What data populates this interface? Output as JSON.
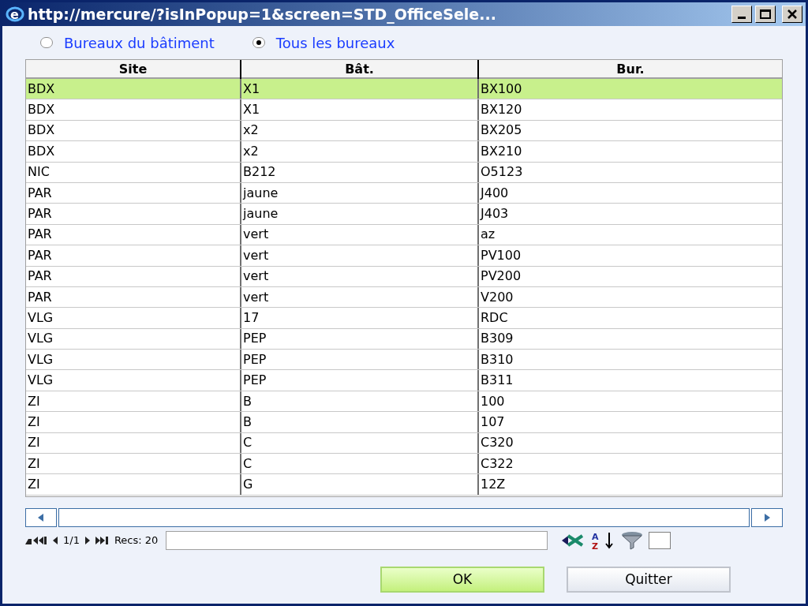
{
  "window": {
    "logo_letter": "e",
    "title": "http://mercure/?isInPopup=1&screen=STD_OfficeSele..."
  },
  "scope_options": [
    {
      "label": "Bureaux du bâtiment",
      "selected": false
    },
    {
      "label": "Tous les bureaux",
      "selected": true
    }
  ],
  "table": {
    "columns": [
      "Site",
      "Bât.",
      "Bur."
    ],
    "rows": [
      {
        "cells": [
          "BDX",
          "X1",
          "BX100"
        ],
        "selected": true
      },
      {
        "cells": [
          "BDX",
          "X1",
          "BX120"
        ],
        "selected": false
      },
      {
        "cells": [
          "BDX",
          "x2",
          "BX205"
        ],
        "selected": false
      },
      {
        "cells": [
          "BDX",
          "x2",
          "BX210"
        ],
        "selected": false
      },
      {
        "cells": [
          "NIC",
          "B212",
          "O5123"
        ],
        "selected": false
      },
      {
        "cells": [
          "PAR",
          "jaune",
          "J400"
        ],
        "selected": false
      },
      {
        "cells": [
          "PAR",
          "jaune",
          "J403"
        ],
        "selected": false
      },
      {
        "cells": [
          "PAR",
          "vert",
          "az"
        ],
        "selected": false
      },
      {
        "cells": [
          "PAR",
          "vert",
          "PV100"
        ],
        "selected": false
      },
      {
        "cells": [
          "PAR",
          "vert",
          "PV200"
        ],
        "selected": false
      },
      {
        "cells": [
          "PAR",
          "vert",
          "V200"
        ],
        "selected": false
      },
      {
        "cells": [
          "VLG",
          "17",
          "RDC"
        ],
        "selected": false
      },
      {
        "cells": [
          "VLG",
          "PEP",
          "B309"
        ],
        "selected": false
      },
      {
        "cells": [
          "VLG",
          "PEP",
          "B310"
        ],
        "selected": false
      },
      {
        "cells": [
          "VLG",
          "PEP",
          "B311"
        ],
        "selected": false
      },
      {
        "cells": [
          "ZI",
          "B",
          "100"
        ],
        "selected": false
      },
      {
        "cells": [
          "ZI",
          "B",
          "107"
        ],
        "selected": false
      },
      {
        "cells": [
          "ZI",
          "C",
          "C320"
        ],
        "selected": false
      },
      {
        "cells": [
          "ZI",
          "C",
          "C322"
        ],
        "selected": false
      },
      {
        "cells": [
          "ZI",
          "G",
          "12Z"
        ],
        "selected": false
      }
    ]
  },
  "pager": {
    "page": "1/1",
    "records": "Recs: 20",
    "sort_letters": [
      "A",
      "Z"
    ],
    "checked": false
  },
  "buttons": [
    {
      "label": "OK",
      "kind": "primary"
    },
    {
      "label": "Quitter",
      "kind": "secondary"
    }
  ]
}
